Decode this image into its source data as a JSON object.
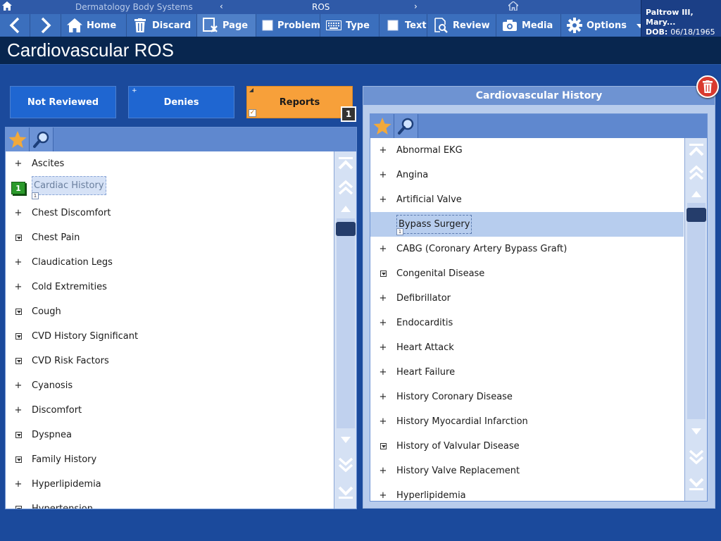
{
  "breadcrumb": {
    "section": "Dermatology Body Systems",
    "current": "ROS",
    "prev_arrow": "‹",
    "next_arrow": "›"
  },
  "toolbar": {
    "home": "Home",
    "discard": "Discard",
    "page": "Page",
    "problem": "Problem",
    "type": "Type",
    "text": "Text",
    "review": "Review",
    "media": "Media",
    "options": "Options"
  },
  "patient": {
    "name": "Paltrow III, Mary...",
    "dob_label": "DOB:",
    "dob": "06/18/1965"
  },
  "page_title": "Cardiovascular ROS",
  "status_buttons": {
    "not_reviewed": "Not Reviewed",
    "denies": "Denies",
    "reports": "Reports",
    "reports_count": "1"
  },
  "left_list": {
    "items": [
      {
        "label": "Ascites",
        "expander": "plus"
      },
      {
        "label": "Cardiac History",
        "expander": "badge",
        "badge": "1"
      },
      {
        "label": "Chest Discomfort",
        "expander": "plus"
      },
      {
        "label": "Chest Pain",
        "expander": "box"
      },
      {
        "label": "Claudication Legs",
        "expander": "plus"
      },
      {
        "label": "Cold Extremities",
        "expander": "plus"
      },
      {
        "label": "Cough",
        "expander": "box"
      },
      {
        "label": "CVD History Significant",
        "expander": "box"
      },
      {
        "label": "CVD Risk Factors",
        "expander": "box"
      },
      {
        "label": "Cyanosis",
        "expander": "plus"
      },
      {
        "label": "Discomfort",
        "expander": "plus"
      },
      {
        "label": "Dyspnea",
        "expander": "box"
      },
      {
        "label": "Family History",
        "expander": "box"
      },
      {
        "label": "Hyperlipidemia",
        "expander": "plus"
      },
      {
        "label": "Hypertension",
        "expander": "box"
      }
    ]
  },
  "right_panel": {
    "title": "Cardiovascular History",
    "items": [
      {
        "label": "Abnormal EKG",
        "expander": "plus"
      },
      {
        "label": "Angina",
        "expander": "plus"
      },
      {
        "label": "Artificial Valve",
        "expander": "plus"
      },
      {
        "label": "Bypass Surgery",
        "expander": "none",
        "selected": true
      },
      {
        "label": "CABG (Coronary Artery Bypass Graft)",
        "expander": "plus"
      },
      {
        "label": "Congenital Disease",
        "expander": "box"
      },
      {
        "label": "Defibrillator",
        "expander": "plus"
      },
      {
        "label": "Endocarditis",
        "expander": "plus"
      },
      {
        "label": "Heart Attack",
        "expander": "plus"
      },
      {
        "label": "Heart Failure",
        "expander": "plus"
      },
      {
        "label": "History Coronary Disease",
        "expander": "plus"
      },
      {
        "label": "History Myocardial Infarction",
        "expander": "plus"
      },
      {
        "label": "History of Valvular Disease",
        "expander": "box"
      },
      {
        "label": "History Valve  Replacement",
        "expander": "plus"
      },
      {
        "label": "Hyperlipidemia",
        "expander": "plus"
      }
    ]
  },
  "colors": {
    "background": "#1b4a9c",
    "toolbar": "#3b6fbd",
    "title_bar": "#08264f",
    "status_blue": "#1f66d1",
    "reports_orange": "#f7a03a",
    "selection": "#b7cdee",
    "delete_red": "#d93a2e"
  }
}
